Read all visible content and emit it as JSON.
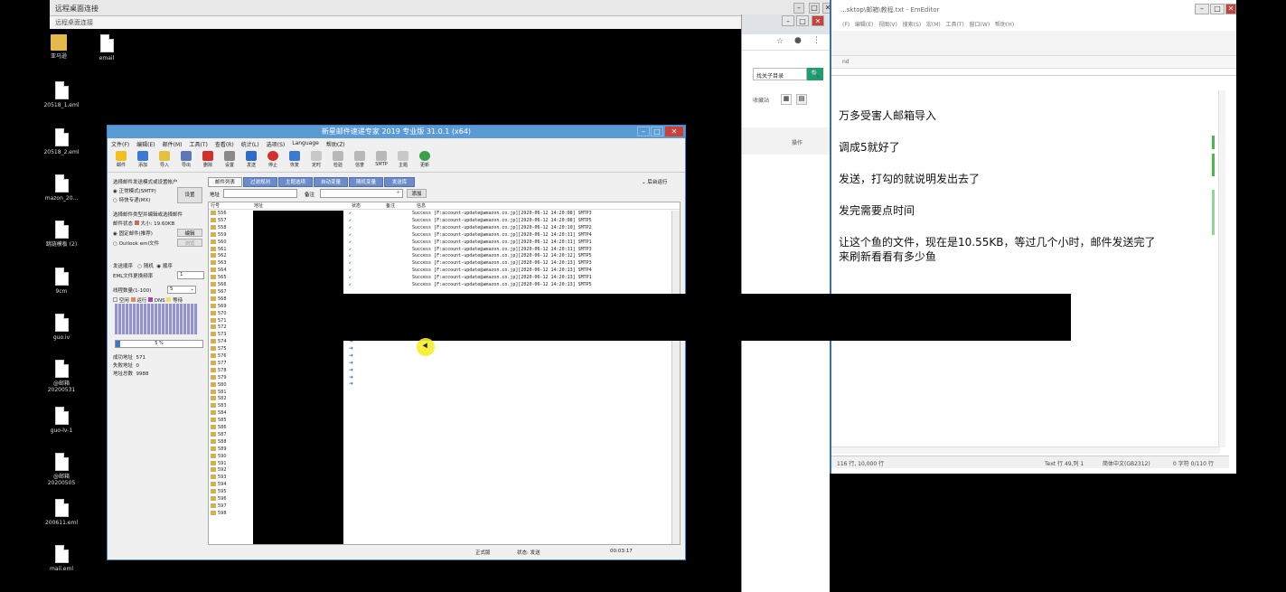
{
  "remote_desktop": {
    "title": "远程桌面连接",
    "topbar_label": "远程桌面连接",
    "ctrl_min": "–",
    "ctrl_max": "□",
    "ctrl_close": "✕"
  },
  "desktop_icons": [
    "亚马逊",
    "email",
    "20518_1.eml",
    "20518_2.eml",
    "mazon_20...",
    "跳链模板 (2)",
    "9cm",
    "guo.iv",
    "@邮箱\n20200531",
    "guo-lv-1",
    "@邮箱\n20200505",
    "200611.eml",
    "mail.eml"
  ],
  "browser": {
    "search_text": "找关子目录",
    "search_btn": "🔍",
    "band_text": "操作",
    "side_text": "收藏站"
  },
  "editor": {
    "title": "...sktop\\邮箱\\教程.txt - EmEditor",
    "menu": [
      "(F)",
      "编辑(E)",
      "视图(V)",
      "搜索(S)",
      "宏(M)",
      "工具(T)",
      "窗口(W)",
      "帮助(H)"
    ],
    "tab_label": "nd",
    "lines": [
      "万多受害人邮箱导入",
      "调成5就好了",
      "发送，打勾的就说明发出去了",
      "发完需要点时间",
      "让这个鱼的文件，现在是10.55KB，等过几个小时，邮件发送完了",
      "来刷新看看有多少鱼"
    ],
    "status_left": "116 行, 10,000 行",
    "status_mid": "Text  行 49,列 1",
    "status_enc": "简体中文(GB2312)",
    "status_right": "0 字符  0/110 行"
  },
  "app": {
    "title": "新星邮件速递专家 2019 专业版 31.0.1 (x64)",
    "menu": [
      "文件(F)",
      "编辑(E)",
      "邮件(M)",
      "工具(T)",
      "查看(R)",
      "统计(L)",
      "选项(S)",
      "Language",
      "帮助(Z)"
    ],
    "tools": [
      "邮件",
      "添加",
      "导入",
      "导出",
      "删除",
      "设置",
      "发送",
      "停止",
      "恢复",
      "定时",
      "检验",
      "信誉",
      "SMTP",
      "主题",
      "更新"
    ],
    "left": {
      "mode_title": "选择邮件发送模式或设置帐户",
      "mode_normal": "正常模式(SMTP)",
      "mode_special": "特快专递(MX)",
      "settings_btn": "设置",
      "src_title": "选择邮件类型并编辑或选择邮件",
      "mail_status": "邮件状态",
      "mail_size": "大小: 19.60KB",
      "fixed_mail": "固定邮件(推荐)",
      "edit_btn": "编辑",
      "outlook": "Outlook eml文件",
      "browse_btn": "浏览",
      "order_label": "发送顺序",
      "order_random": "随机",
      "order_seq": "顺序",
      "eml_label": "EML文件更换频率",
      "eml_value": "1",
      "threads_label": "线程数量(1-100)",
      "threads_value": "5",
      "legend": [
        "空闲",
        "运行",
        "DNS",
        "等待"
      ],
      "progress_text": "5 %",
      "progress_value": 0.05,
      "success_label": "成功地址",
      "success_value": "571",
      "fail_label": "失败地址",
      "fail_value": "0",
      "total_label": "地址总数",
      "total_value": "9988"
    },
    "tabs": [
      "邮件列表",
      "过滤规则",
      "主题选项",
      "自动变量",
      "随机变量",
      "发送库"
    ],
    "collapse_label": "后台运行",
    "filter_label": "地址",
    "note_label": "备注",
    "add_btn": "添加",
    "columns": [
      "行号",
      "地址",
      "状态",
      "备注",
      "信息"
    ],
    "row_numbers": [
      "556",
      "557",
      "558",
      "559",
      "560",
      "561",
      "562",
      "563",
      "564",
      "565",
      "566",
      "567",
      "568",
      "569",
      "570",
      "571",
      "572",
      "573",
      "574",
      "575",
      "576",
      "577",
      "578",
      "579",
      "580",
      "581",
      "582",
      "583",
      "584",
      "585",
      "586",
      "587",
      "588",
      "589",
      "590",
      "591",
      "592",
      "593",
      "594",
      "595",
      "596",
      "597",
      "598"
    ],
    "ok_rows": [
      "Success  [F:account-update@amazon.co.jp][2020-06-12 14:20:08] SMTP3",
      "Success  [F:account-update@amazon.co.jp][2020-06-12 14:20:08] SMTP5",
      "Success  [F:account-update@amazon.co.jp][2020-06-12 14:20:10] SMTP2",
      "Success  [F:account-update@amazon.co.jp][2020-06-12 14:20:11] SMTP4",
      "Success  [F:account-update@amazon.co.jp][2020-06-12 14:20:11] SMTP1",
      "Success  [F:account-update@amazon.co.jp][2020-06-12 14:20:11] SMTP3",
      "Success  [F:account-update@amazon.co.jp][2020-06-12 14:20:12] SMTP5",
      "Success  [F:account-update@amazon.co.jp][2020-06-12 14:20:13] SMTP3",
      "Success  [F:account-update@amazon.co.jp][2020-06-12 14:20:13] SMTP4",
      "Success  [F:account-update@amazon.co.jp][2020-06-12 14:20:13] SMTP1",
      "Success  [F:account-update@amazon.co.jp][2020-06-12 14:20:13] SMTP5"
    ],
    "status_mode": "正式版",
    "status_state": "状态: 发送",
    "status_time": "00:03:17"
  }
}
